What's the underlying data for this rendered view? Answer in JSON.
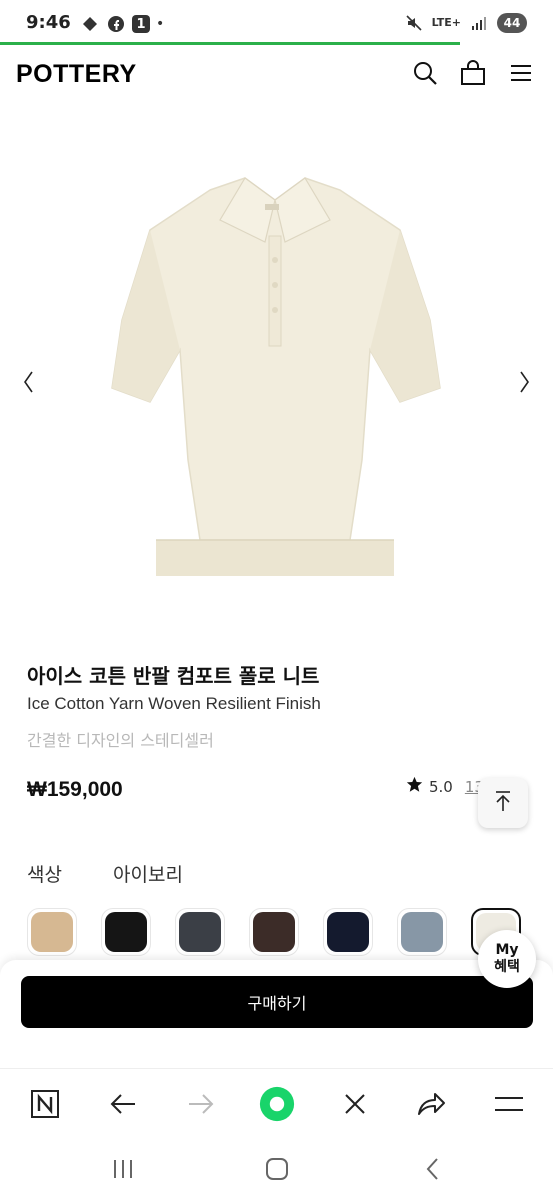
{
  "status_bar": {
    "time": "9:46",
    "notification_count": "1",
    "dot": "•",
    "network": "LTE+",
    "battery": "44",
    "icons": [
      "chat-bubble-icon",
      "facebook-icon",
      "mute-icon",
      "signal-icon"
    ]
  },
  "header": {
    "logo": "POTTERY",
    "icons": [
      "search-icon",
      "bag-icon",
      "menu-icon"
    ]
  },
  "product": {
    "title_ko": "아이스 코튼 반팔 컴포트 폴로 니트",
    "title_en": "Ice Cotton Yarn Woven Resilient Finish",
    "subtitle": "간결한 디자인의 스테디셀러",
    "price": "₩159,000",
    "rating": "5.0",
    "review_count": "13",
    "image": "ivory-polo-knit-image"
  },
  "options": {
    "color_label": "색상",
    "selected_color": "아이보리",
    "swatches": [
      {
        "name": "beige",
        "hex": "#d6b892"
      },
      {
        "name": "black",
        "hex": "#151515"
      },
      {
        "name": "charcoal",
        "hex": "#3b3f46"
      },
      {
        "name": "brown",
        "hex": "#3c2c28"
      },
      {
        "name": "navy",
        "hex": "#141a2e"
      },
      {
        "name": "blue-gray",
        "hex": "#8797a6"
      },
      {
        "name": "ivory",
        "hex": "#eeebe2"
      }
    ]
  },
  "my_benefit": {
    "line1": "My",
    "line2": "혜택"
  },
  "buy": {
    "label": "구매하기"
  },
  "browser_toolbar": [
    "naver-icon",
    "back-icon",
    "forward-icon",
    "home-dot-icon",
    "close-icon",
    "share-icon",
    "menu-icon"
  ],
  "system_nav": [
    "recents-icon",
    "home-icon",
    "back-icon"
  ],
  "colors": {
    "accent_green": "#2bb04a",
    "buy_button": "#000000"
  }
}
